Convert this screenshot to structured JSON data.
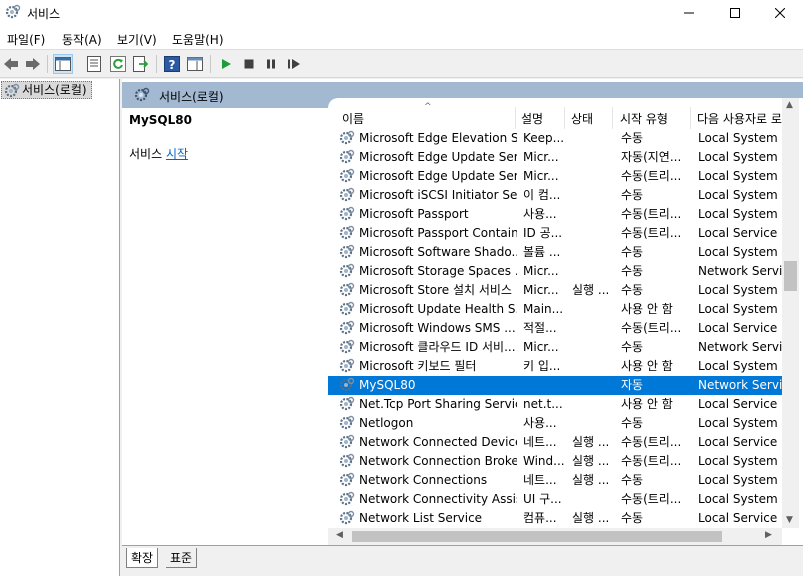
{
  "window": {
    "title": "서비스"
  },
  "menu": {
    "items": [
      "파일(F)",
      "동작(A)",
      "보기(V)",
      "도움말(H)"
    ]
  },
  "tree": {
    "root_label": "서비스(로컬)"
  },
  "pane_header": {
    "label": "서비스(로컬)"
  },
  "description": {
    "service_name": "MySQL80",
    "action_prefix": "서비스 ",
    "action_link": "시작"
  },
  "table": {
    "columns": [
      "이름",
      "설명",
      "상태",
      "시작 유형",
      "다음 사용자로 로"
    ],
    "rows": [
      {
        "name": "Microsoft Edge Elevation S...",
        "desc": "Keep...",
        "status": "",
        "start": "수동",
        "logon": "Local System"
      },
      {
        "name": "Microsoft Edge Update Ser...",
        "desc": "Micr...",
        "status": "",
        "start": "자동(지연...",
        "logon": "Local System"
      },
      {
        "name": "Microsoft Edge Update Ser...",
        "desc": "Micr...",
        "status": "",
        "start": "수동(트리...",
        "logon": "Local System"
      },
      {
        "name": "Microsoft iSCSI Initiator Se...",
        "desc": "이 컴...",
        "status": "",
        "start": "수동",
        "logon": "Local System"
      },
      {
        "name": "Microsoft Passport",
        "desc": "사용...",
        "status": "",
        "start": "수동(트리...",
        "logon": "Local System"
      },
      {
        "name": "Microsoft Passport Container",
        "desc": "ID 공...",
        "status": "",
        "start": "수동(트리...",
        "logon": "Local Service"
      },
      {
        "name": "Microsoft Software Shado...",
        "desc": "볼륨 ...",
        "status": "",
        "start": "수동",
        "logon": "Local System"
      },
      {
        "name": "Microsoft Storage Spaces ...",
        "desc": "Micr...",
        "status": "",
        "start": "수동",
        "logon": "Network Service"
      },
      {
        "name": "Microsoft Store 설치 서비스",
        "desc": "Micr...",
        "status": "실행 ...",
        "start": "수동",
        "logon": "Local System"
      },
      {
        "name": "Microsoft Update Health S...",
        "desc": "Main...",
        "status": "",
        "start": "사용 안 함",
        "logon": "Local System"
      },
      {
        "name": "Microsoft Windows SMS ...",
        "desc": "적절...",
        "status": "",
        "start": "수동(트리...",
        "logon": "Local Service"
      },
      {
        "name": "Microsoft 클라우드 ID 서비...",
        "desc": "Micr...",
        "status": "",
        "start": "수동",
        "logon": "Network Service"
      },
      {
        "name": "Microsoft 키보드 필터",
        "desc": "키 입...",
        "status": "",
        "start": "사용 안 함",
        "logon": "Local System"
      },
      {
        "name": "MySQL80",
        "desc": "",
        "status": "",
        "start": "자동",
        "logon": "Network Service",
        "selected": true
      },
      {
        "name": "Net.Tcp Port Sharing Service",
        "desc": "net.t...",
        "status": "",
        "start": "사용 안 함",
        "logon": "Local Service"
      },
      {
        "name": "Netlogon",
        "desc": "사용...",
        "status": "",
        "start": "수동",
        "logon": "Local System"
      },
      {
        "name": "Network Connected Device...",
        "desc": "네트...",
        "status": "실행 ...",
        "start": "수동(트리...",
        "logon": "Local Service"
      },
      {
        "name": "Network Connection Broker",
        "desc": "Wind...",
        "status": "실행 ...",
        "start": "수동(트리...",
        "logon": "Local System"
      },
      {
        "name": "Network Connections",
        "desc": "네트...",
        "status": "실행 ...",
        "start": "수동",
        "logon": "Local System"
      },
      {
        "name": "Network Connectivity Assis...",
        "desc": "UI 구...",
        "status": "",
        "start": "수동(트리...",
        "logon": "Local System"
      },
      {
        "name": "Network List Service",
        "desc": "컴퓨...",
        "status": "실행 ...",
        "start": "수동",
        "logon": "Local Service"
      }
    ]
  },
  "tabs": {
    "extended": "확장",
    "standard": "표준"
  },
  "colors": {
    "selection": "#0078d7",
    "header_band": "#a3b8d1",
    "link": "#0066cc"
  }
}
